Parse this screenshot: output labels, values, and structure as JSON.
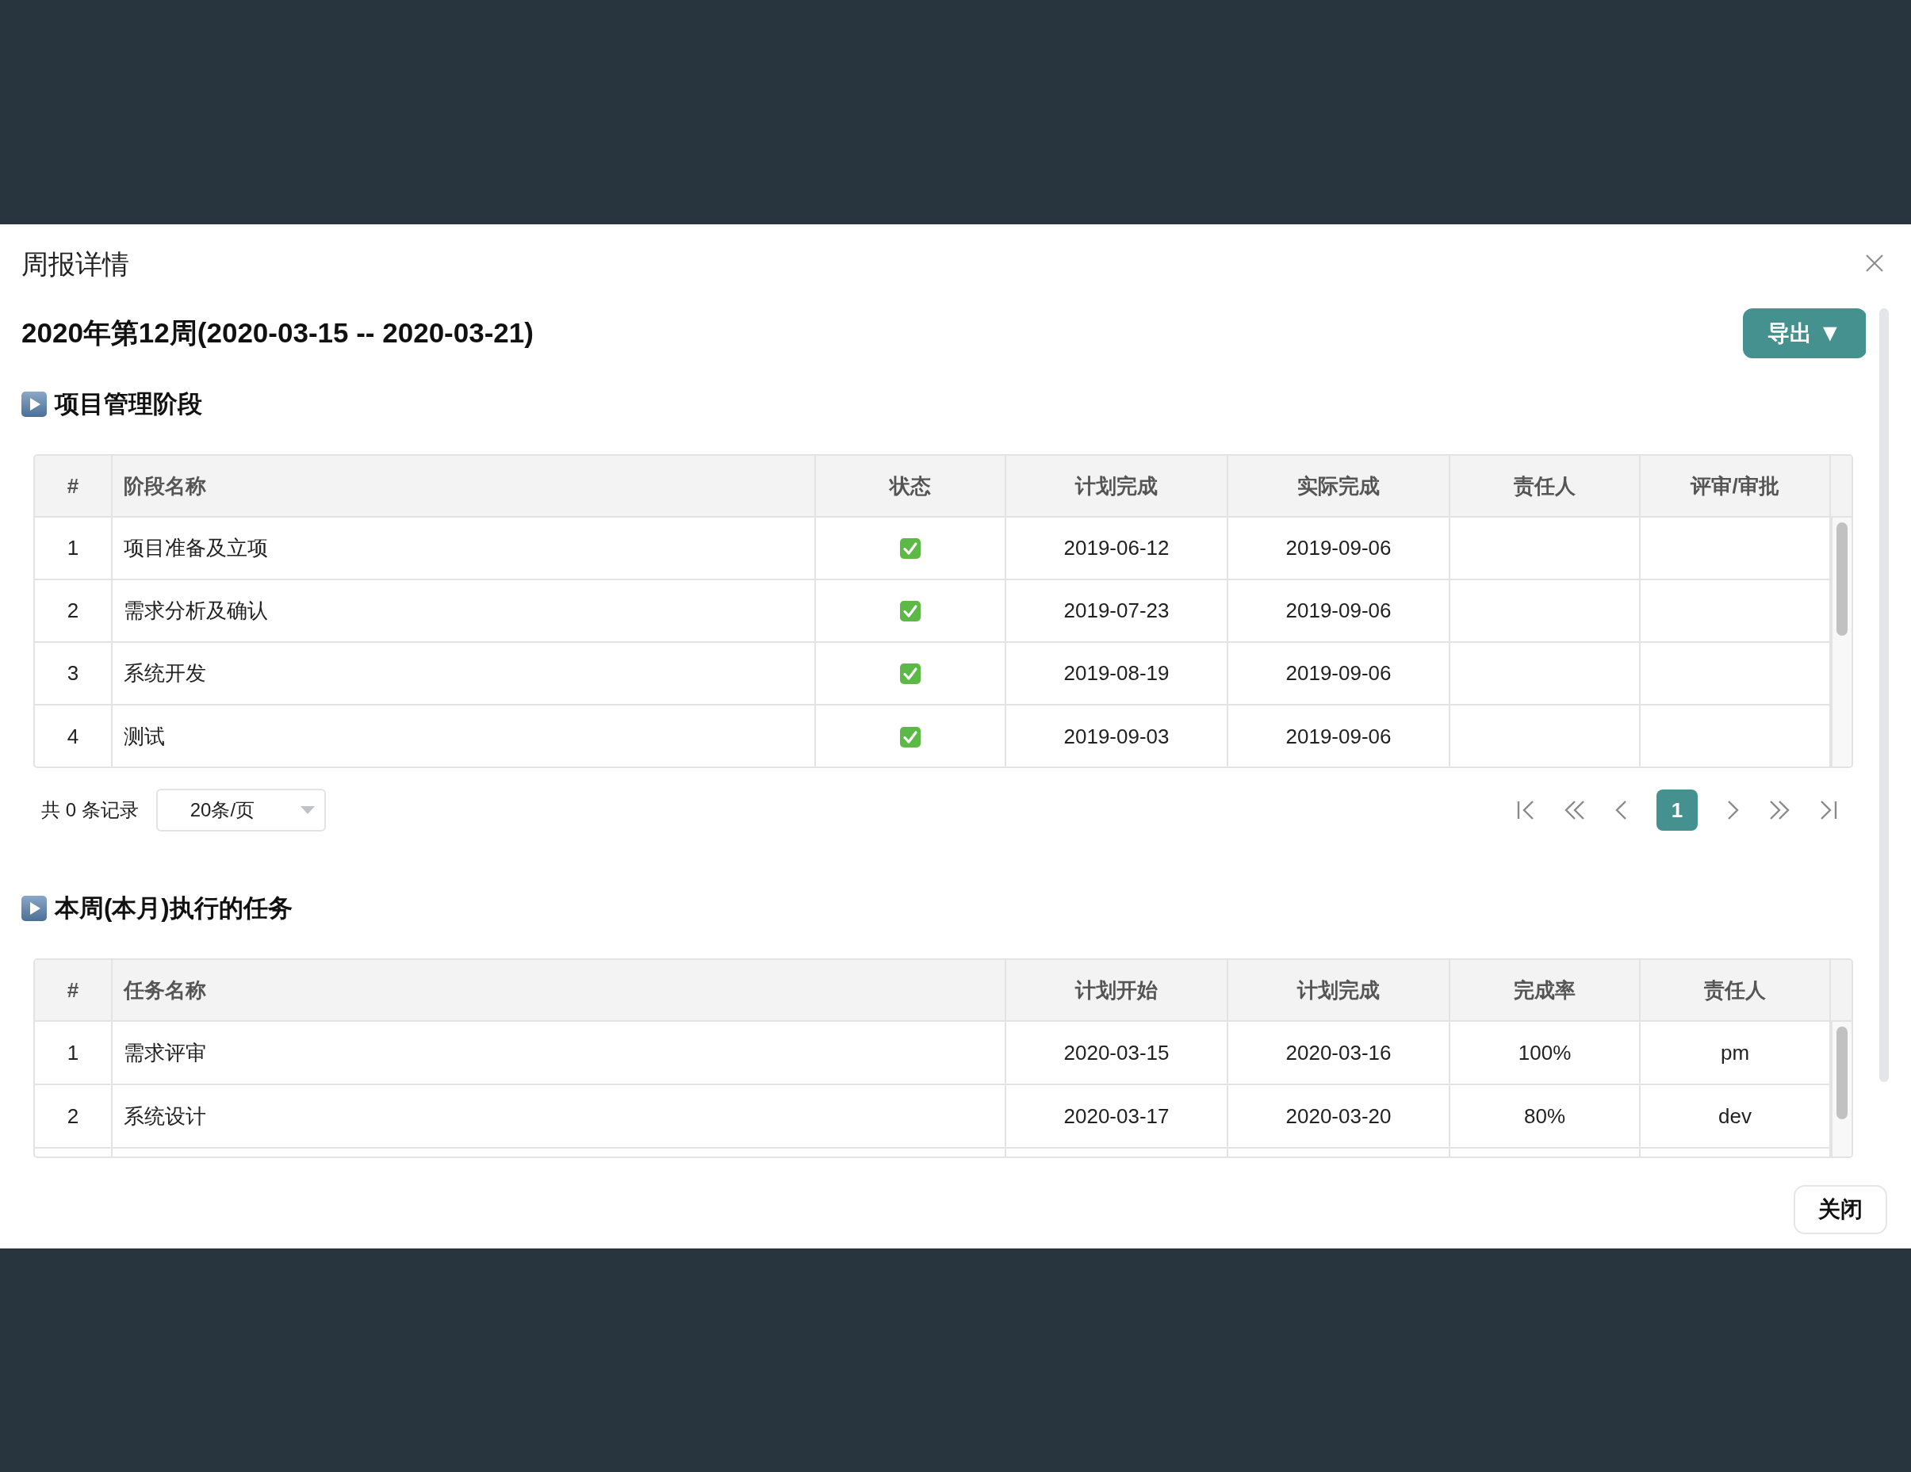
{
  "dialog": {
    "title": "周报详情",
    "footer_buttons": [
      "关闭"
    ]
  },
  "report_heading": "2020年第12周(2020-03-15 -- 2020-03-21)",
  "export_button": {
    "label": "导出",
    "caret": "▼"
  },
  "sections": [
    {
      "title": "项目管理阶段",
      "table": {
        "columns": [
          {
            "label": "#",
            "kind": "index"
          },
          {
            "label": "阶段名称",
            "kind": "name"
          },
          {
            "label": "状态",
            "kind": "check"
          },
          {
            "label": "计划完成",
            "kind": "text"
          },
          {
            "label": "实际完成",
            "kind": "text"
          },
          {
            "label": "责任人",
            "kind": "text"
          },
          {
            "label": "评审/审批",
            "kind": "text"
          }
        ],
        "rows": [
          {
            "cells": [
              "1",
              "项目准备及立项",
              true,
              "2019-06-12",
              "2019-09-06",
              null,
              null
            ]
          },
          {
            "cells": [
              "2",
              "需求分析及确认",
              true,
              "2019-07-23",
              "2019-09-06",
              null,
              null
            ]
          },
          {
            "cells": [
              "3",
              "系统开发",
              true,
              "2019-08-19",
              "2019-09-06",
              null,
              null
            ]
          },
          {
            "cells": [
              "4",
              "测试",
              true,
              "2019-09-03",
              "2019-09-06",
              null,
              null
            ]
          }
        ]
      },
      "pagination": {
        "summary": "共 0 条记录",
        "page_size": "20条/页",
        "pages": [
          {
            "label": "1",
            "selected": true
          }
        ]
      }
    },
    {
      "title": "本周(本月)执行的任务",
      "table": {
        "columns": [
          {
            "label": "#",
            "kind": "index"
          },
          {
            "label": "任务名称",
            "kind": "name"
          },
          {
            "label": "计划开始",
            "kind": "text"
          },
          {
            "label": "计划完成",
            "kind": "text"
          },
          {
            "label": "完成率",
            "kind": "text"
          },
          {
            "label": "责任人",
            "kind": "text"
          }
        ],
        "rows": [
          {
            "cells": [
              "1",
              "需求评审",
              "2020-03-15",
              "2020-03-16",
              "100%",
              "pm"
            ]
          },
          {
            "cells": [
              "2",
              "系统设计",
              "2020-03-17",
              "2020-03-20",
              "80%",
              "dev"
            ]
          }
        ]
      }
    }
  ]
}
